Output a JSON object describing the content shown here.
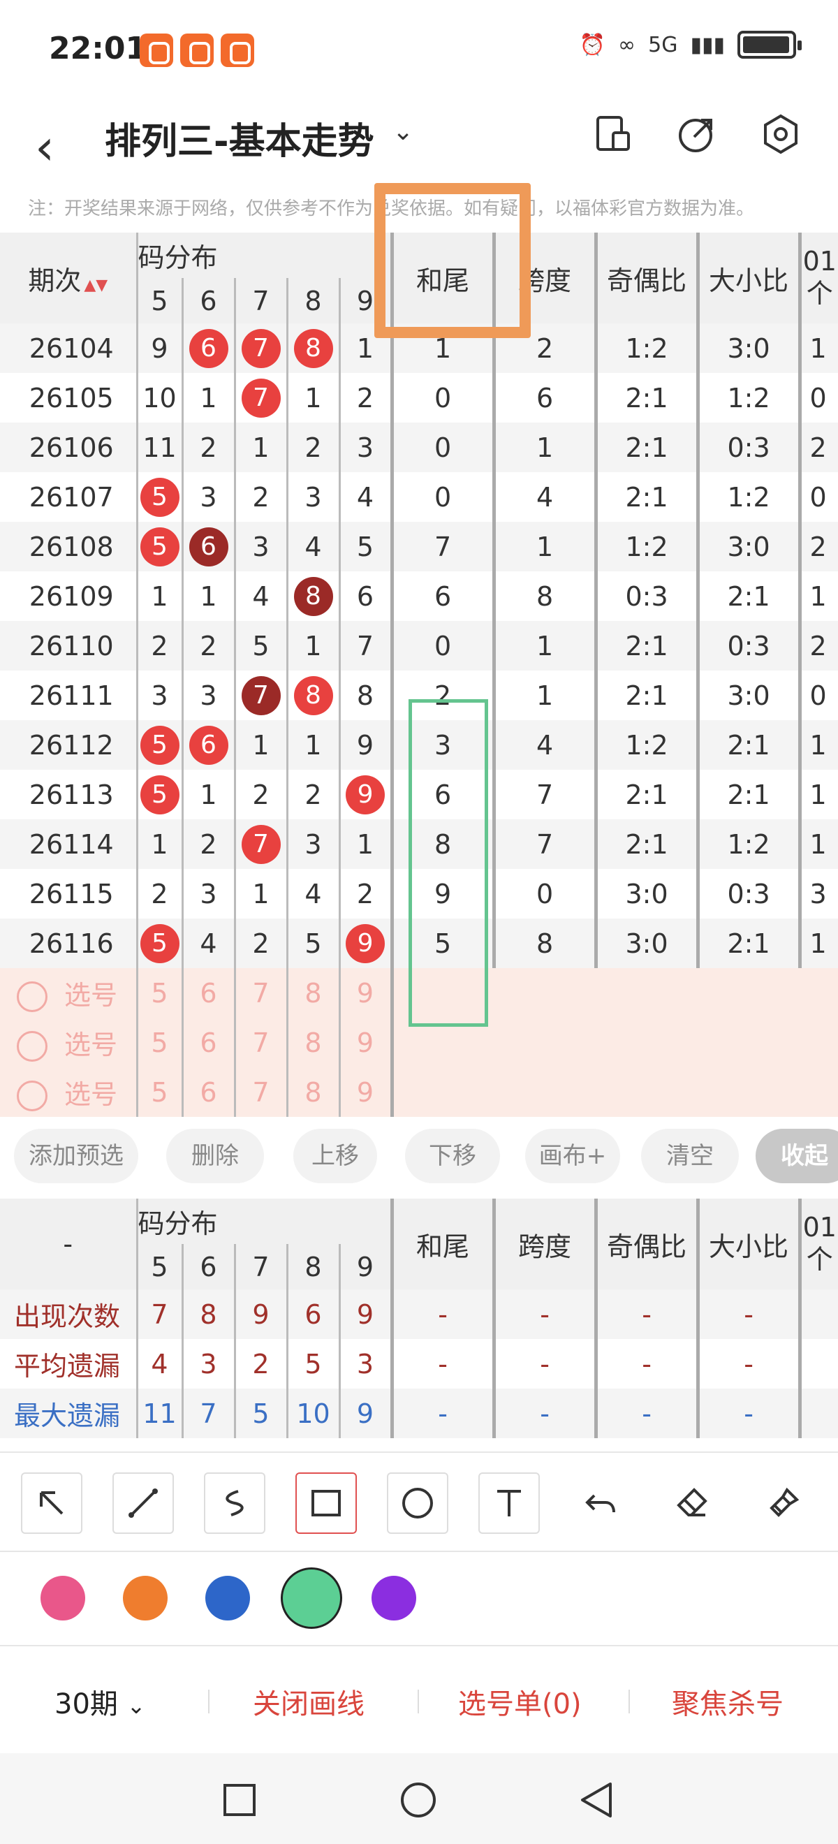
{
  "status": {
    "time": "22:01",
    "signal": "5G"
  },
  "header": {
    "title": "排列三-基本走势"
  },
  "note": "注：开奖结果来源于网络，仅供参考不作为兑奖依据。如有疑问，以福体彩官方数据为准。",
  "table": {
    "col_issue": "期次",
    "group_label": "码分布",
    "digits": [
      "5",
      "6",
      "7",
      "8",
      "9"
    ],
    "col_hewei": "和尾",
    "col_kuadu": "跨度",
    "col_jiou": "奇偶比",
    "col_daxiao": "大小比",
    "col_extra_top": "01",
    "col_extra_bottom": "个",
    "rows": [
      {
        "issue": "26104",
        "d": [
          "9",
          "6",
          "7",
          "8",
          "1"
        ],
        "hewei": "1",
        "kuadu": "2",
        "jiou": "1:2",
        "daxiao": "3:0",
        "extra": "1"
      },
      {
        "issue": "26105",
        "d": [
          "10",
          "1",
          "7",
          "1",
          "2"
        ],
        "hewei": "0",
        "kuadu": "6",
        "jiou": "2:1",
        "daxiao": "1:2",
        "extra": "0"
      },
      {
        "issue": "26106",
        "d": [
          "11",
          "2",
          "1",
          "2",
          "3"
        ],
        "hewei": "0",
        "kuadu": "1",
        "jiou": "2:1",
        "daxiao": "0:3",
        "extra": "2"
      },
      {
        "issue": "26107",
        "d": [
          "5",
          "3",
          "2",
          "3",
          "4"
        ],
        "hewei": "0",
        "kuadu": "4",
        "jiou": "2:1",
        "daxiao": "1:2",
        "extra": "0"
      },
      {
        "issue": "26108",
        "d": [
          "5",
          "6",
          "3",
          "4",
          "5"
        ],
        "hewei": "7",
        "kuadu": "1",
        "jiou": "1:2",
        "daxiao": "3:0",
        "extra": "2"
      },
      {
        "issue": "26109",
        "d": [
          "1",
          "1",
          "4",
          "8",
          "6"
        ],
        "hewei": "6",
        "kuadu": "8",
        "jiou": "0:3",
        "daxiao": "2:1",
        "extra": "1"
      },
      {
        "issue": "26110",
        "d": [
          "2",
          "2",
          "5",
          "1",
          "7"
        ],
        "hewei": "0",
        "kuadu": "1",
        "jiou": "2:1",
        "daxiao": "0:3",
        "extra": "2"
      },
      {
        "issue": "26111",
        "d": [
          "3",
          "3",
          "7",
          "8",
          "8"
        ],
        "hewei": "2",
        "kuadu": "1",
        "jiou": "2:1",
        "daxiao": "3:0",
        "extra": "0"
      },
      {
        "issue": "26112",
        "d": [
          "5",
          "6",
          "1",
          "1",
          "9"
        ],
        "hewei": "3",
        "kuadu": "4",
        "jiou": "1:2",
        "daxiao": "2:1",
        "extra": "1"
      },
      {
        "issue": "26113",
        "d": [
          "5",
          "1",
          "2",
          "2",
          "9"
        ],
        "hewei": "6",
        "kuadu": "7",
        "jiou": "2:1",
        "daxiao": "2:1",
        "extra": "1"
      },
      {
        "issue": "26114",
        "d": [
          "1",
          "2",
          "7",
          "3",
          "1"
        ],
        "hewei": "8",
        "kuadu": "7",
        "jiou": "2:1",
        "daxiao": "1:2",
        "extra": "1"
      },
      {
        "issue": "26115",
        "d": [
          "2",
          "3",
          "1",
          "4",
          "2"
        ],
        "hewei": "9",
        "kuadu": "0",
        "jiou": "3:0",
        "daxiao": "0:3",
        "extra": "3"
      },
      {
        "issue": "26116",
        "d": [
          "5",
          "4",
          "2",
          "5",
          "9"
        ],
        "hewei": "5",
        "kuadu": "8",
        "jiou": "3:0",
        "daxiao": "2:1",
        "extra": "1"
      }
    ],
    "pick_label": "选号"
  },
  "actions": [
    "添加预选",
    "删除",
    "上移",
    "下移",
    "画布+",
    "清空",
    "收起"
  ],
  "stats": {
    "dash": "-",
    "rows": [
      {
        "label": "出现次数",
        "vals": [
          "7",
          "8",
          "9",
          "6",
          "9"
        ],
        "color": "#a0302a"
      },
      {
        "label": "平均遗漏",
        "vals": [
          "4",
          "3",
          "2",
          "5",
          "3"
        ],
        "color": "#a0302a"
      },
      {
        "label": "最大遗漏",
        "vals": [
          "11",
          "7",
          "5",
          "10",
          "9"
        ],
        "color": "#3a6fc4"
      }
    ]
  },
  "tools": [
    "arrow-icon",
    "line-icon",
    "freehand-icon",
    "rectangle-icon",
    "circle-icon",
    "text-icon",
    "undo-icon",
    "eraser-icon",
    "clear-brush-icon"
  ],
  "palette": [
    "#e9578a",
    "#ef7d2e",
    "#2d66c9",
    "#5ccf94",
    "#8b2ee0"
  ],
  "bottom": {
    "periods": "30期",
    "close_draw": "关闭画线",
    "pick_list": "选号单(0)",
    "focus_kill": "聚焦杀号"
  }
}
